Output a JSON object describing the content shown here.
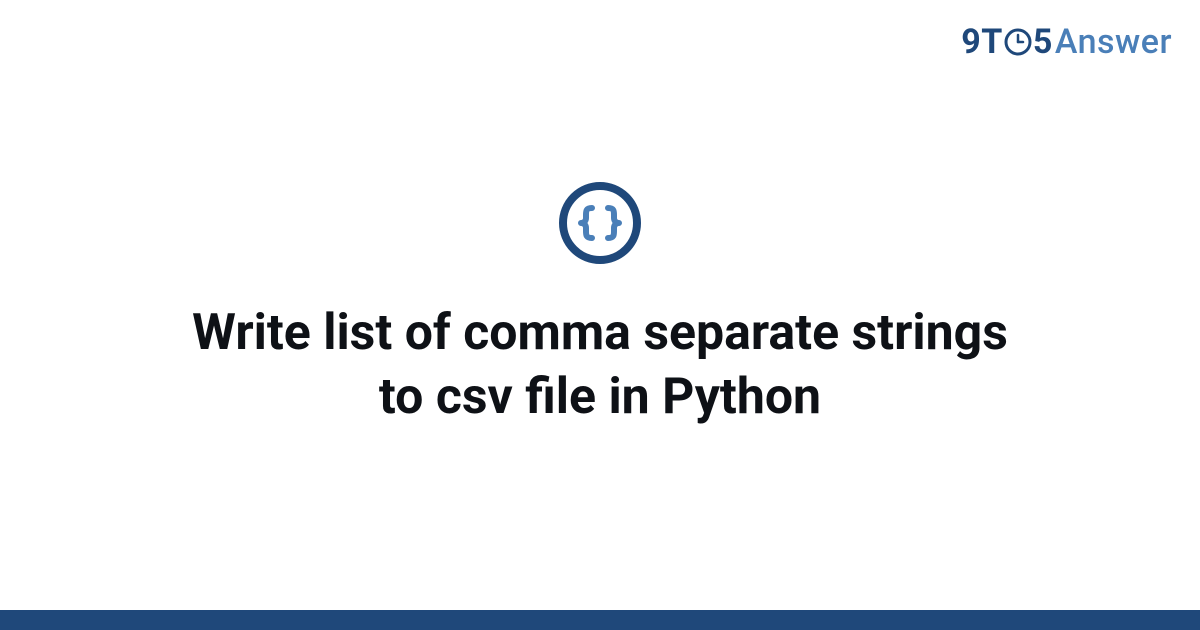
{
  "brand": {
    "part_nine": "9",
    "part_t": "T",
    "part_five": "5",
    "part_answer": "Answer"
  },
  "category_icon_name": "code-braces-icon",
  "title": "Write list of comma separate strings to csv file in Python",
  "colors": {
    "brand_dark": "#1f487a",
    "brand_light": "#4a7fb8",
    "icon_ring": "#1f487a",
    "icon_glyph": "#4a7fb8",
    "text": "#0e1116",
    "bar": "#1f487a"
  }
}
